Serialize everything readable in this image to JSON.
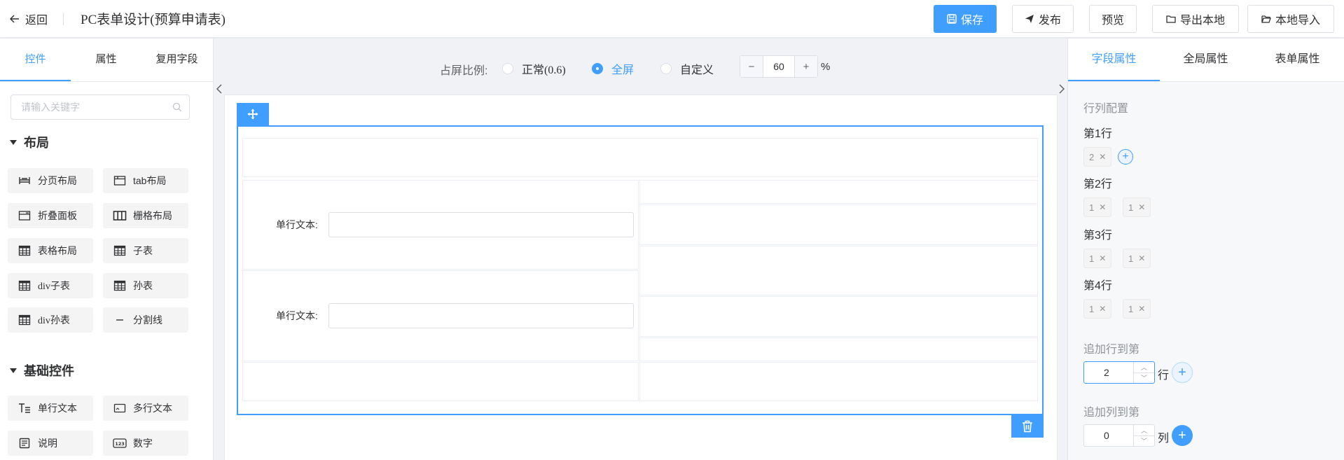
{
  "colors": {
    "accent": "#409eff",
    "border": "#dcdfe6",
    "muted": "#909399"
  },
  "header": {
    "back_label": "返回",
    "title": "PC表单设计(预算申请表)",
    "buttons": {
      "save": "保存",
      "publish": "发布",
      "preview": "预览",
      "export": "导出本地",
      "import": "本地导入"
    }
  },
  "left": {
    "tabs": [
      "控件",
      "属性",
      "复用字段"
    ],
    "search_placeholder": "请输入关键字",
    "layout_title": "布局",
    "layout_items": [
      "分页布局",
      "tab布局",
      "折叠面板",
      "栅格布局",
      "表格布局",
      "子表",
      "div子表",
      "孙表",
      "div孙表",
      "分割线"
    ],
    "basic_title": "基础控件",
    "basic_items": [
      "单行文本",
      "多行文本",
      "说明",
      "数字"
    ]
  },
  "center": {
    "ratio_label": "占屏比例:",
    "ratio_options": [
      "正常(0.6)",
      "全屏",
      "自定义"
    ],
    "ratio_selected": "全屏",
    "zoom_value": "60",
    "zoom_unit": "%",
    "field_label_1": "单行文本:",
    "field_label_2": "单行文本:"
  },
  "right": {
    "tabs": [
      "字段属性",
      "全局属性",
      "表单属性"
    ],
    "section_title": "行列配置",
    "rows": [
      {
        "label": "第1行",
        "tags": [
          "2"
        ]
      },
      {
        "label": "第2行",
        "tags": [
          "1",
          "1"
        ]
      },
      {
        "label": "第3行",
        "tags": [
          "1",
          "1"
        ]
      },
      {
        "label": "第4行",
        "tags": [
          "1",
          "1"
        ]
      }
    ],
    "add_row_label": "追加行到第",
    "add_row_value": "2",
    "add_row_unit": "行",
    "add_col_label": "追加列到第",
    "add_col_value": "0",
    "add_col_unit": "列"
  }
}
